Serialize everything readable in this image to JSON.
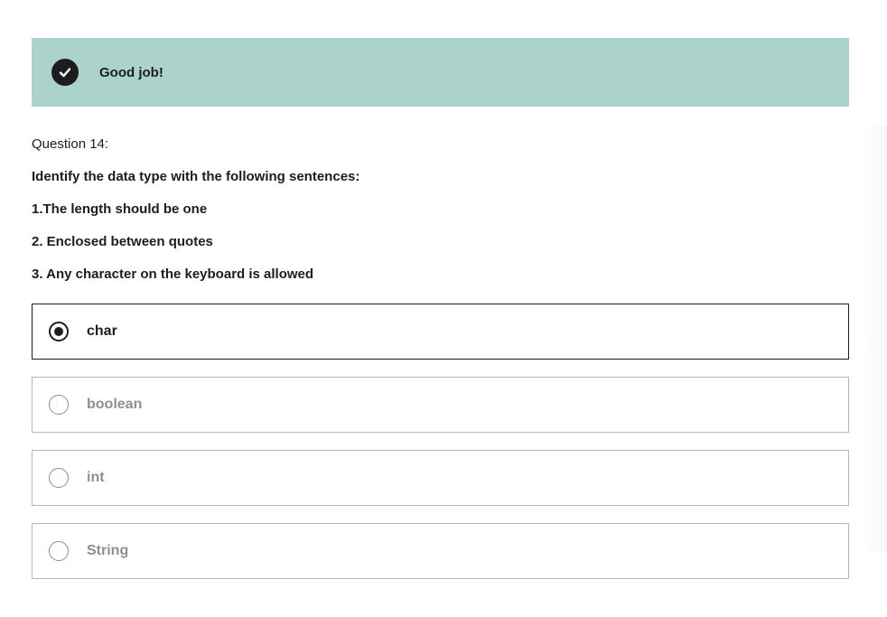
{
  "feedback": {
    "message": "Good job!",
    "icon": "check-circle-icon",
    "background_color": "#acd2cc"
  },
  "question": {
    "number_label": "Question 14:",
    "prompt": "Identify the data type with the following sentences:",
    "lines": [
      "1.The length should be one",
      "2. Enclosed between quotes",
      "3. Any character on the keyboard is allowed"
    ]
  },
  "options": [
    {
      "label": "char",
      "selected": true
    },
    {
      "label": "boolean",
      "selected": false
    },
    {
      "label": "int",
      "selected": false
    },
    {
      "label": "String",
      "selected": false
    }
  ]
}
